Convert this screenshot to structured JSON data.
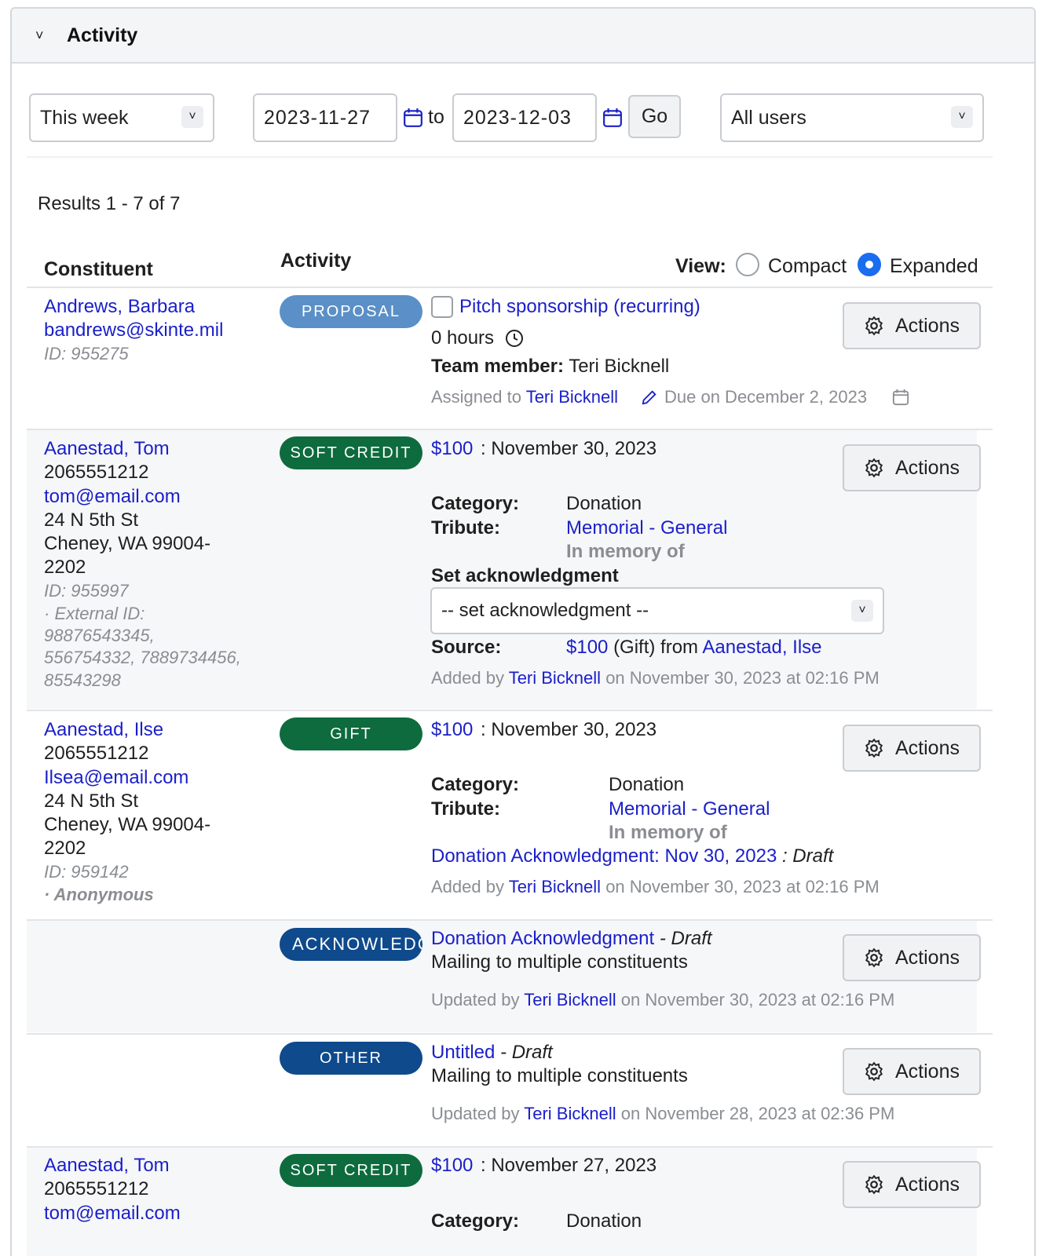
{
  "panel": {
    "title": "Activity"
  },
  "filters": {
    "period": "This week",
    "date_from": "2023-11-27",
    "to_label": "to",
    "date_to": "2023-12-03",
    "go_label": "Go",
    "users": "All users"
  },
  "results_text": "Results 1 - 7 of 7",
  "table": {
    "col_constituent": "Constituent",
    "col_activity": "Activity",
    "view_label": "View:",
    "view_compact": "Compact",
    "view_expanded": "Expanded",
    "actions_label": "Actions"
  },
  "rows": [
    {
      "name": "Andrews, Barbara",
      "email": "bandrews@skinte.mil",
      "id": "ID: 955275",
      "badge": "PROPOSAL",
      "title": "Pitch sponsorship (recurring)",
      "hours": "0 hours",
      "team_label": "Team member:",
      "team_member": "Teri Bicknell",
      "assigned_prefix": "Assigned to",
      "assigned_to": "Teri Bicknell",
      "due": "Due on December 2, 2023"
    },
    {
      "name": "Aanestad, Tom",
      "phone": "2065551212",
      "email": "tom@email.com",
      "address1": "24 N 5th St",
      "address2": "Cheney, WA 99004-",
      "address3": "2202",
      "id": "ID: 955997",
      "external_label": "· External ID:",
      "external_1": "98876543345,",
      "external_2": "556754332, 7889734456,",
      "external_3": "85543298",
      "badge": "SOFT CREDIT",
      "amount": "$100",
      "date": ": November 30, 2023",
      "category_label": "Category:",
      "category": "Donation",
      "tribute_label": "Tribute:",
      "tribute": "Memorial - General",
      "tribute_note": "In memory of",
      "ack_label": "Set acknowledgment",
      "ack_select": "-- set acknowledgment --",
      "source_label": "Source:",
      "source_amount": "$100",
      "source_mid": "(Gift) from",
      "source_from": "Aanestad, Ilse",
      "added_prefix": "Added by",
      "added_by": "Teri Bicknell",
      "added_suffix": "on November 30, 2023 at 02:16 PM"
    },
    {
      "name": "Aanestad, Ilse",
      "phone": "2065551212",
      "email": "Ilsea@email.com",
      "address1": "24 N 5th St",
      "address2": "Cheney, WA 99004-",
      "address3": "2202",
      "id": "ID: 959142",
      "anonymous": "· Anonymous",
      "badge": "GIFT",
      "amount": "$100",
      "date": ": November 30, 2023",
      "category_label": "Category:",
      "category": "Donation",
      "tribute_label": "Tribute:",
      "tribute": "Memorial - General",
      "tribute_note": "In memory of",
      "ack_link": "Donation Acknowledgment: Nov 30, 2023",
      "ack_status": ": Draft",
      "added_prefix": "Added by",
      "added_by": "Teri Bicknell",
      "added_suffix": "on November 30, 2023 at 02:16 PM"
    },
    {
      "badge": "ACKNOWLEDGMENT",
      "title": "Donation Acknowledgment",
      "status": "- Draft",
      "desc": "Mailing to multiple constituents",
      "updated_prefix": "Updated by",
      "updated_by": "Teri Bicknell",
      "updated_suffix": "on November 30, 2023 at 02:16 PM"
    },
    {
      "badge": "OTHER",
      "title": "Untitled",
      "status": "- Draft",
      "desc": "Mailing to multiple constituents",
      "updated_prefix": "Updated by",
      "updated_by": "Teri Bicknell",
      "updated_suffix": "on November 28, 2023 at 02:36 PM"
    },
    {
      "name": "Aanestad, Tom",
      "phone": "2065551212",
      "email": "tom@email.com",
      "badge": "SOFT CREDIT",
      "amount": "$100",
      "date": ": November 27, 2023",
      "category_label": "Category:",
      "category": "Donation"
    }
  ]
}
